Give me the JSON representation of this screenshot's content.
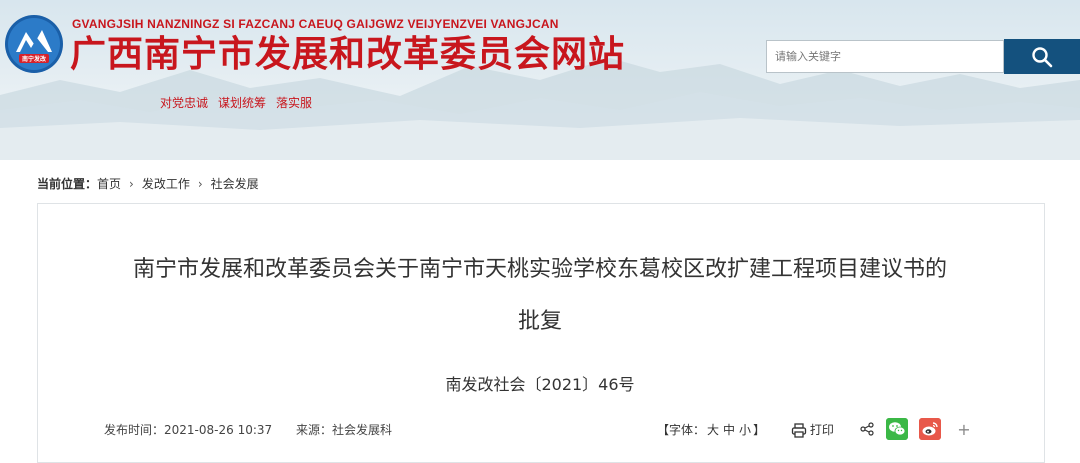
{
  "header": {
    "pinyin": "GVANGJSIH NANZNINGZ SI FAZCANJ CAEUQ GAIJGWZ VEIJYENZVEI VANGJCAN",
    "site_title": "广西南宁市发展和改革委员会网站",
    "logo_text": "南宁发改",
    "motto": [
      "对党忠诚",
      "谋划统筹",
      "落实服"
    ]
  },
  "search": {
    "placeholder": "请输入关键字",
    "value": ""
  },
  "breadcrumb": {
    "label": "当前位置：",
    "items": [
      "首页",
      "发改工作",
      "社会发展"
    ],
    "separator": "›"
  },
  "article": {
    "title_line1": "南宁市发展和改革委员会关于南宁市天桃实验学校东葛校区改扩建工程项目建议书的",
    "title_line2": "批复",
    "doc_number": "南发改社会〔2021〕46号",
    "publish_label": "发布时间：",
    "publish_time": "2021-08-26 10:37",
    "source_label": "来源：",
    "source": "社会发展科"
  },
  "tools": {
    "font_open": "【字体：",
    "font_large": "大",
    "font_medium": "中",
    "font_small": "小",
    "font_close": "】",
    "print": "打印",
    "plus": "+"
  },
  "colors": {
    "brand_red": "#c8161d",
    "search_button": "#14517e",
    "wechat": "#3bb846",
    "weibo": "#e8584a"
  },
  "icons": [
    "logo-emblem-icon",
    "search-icon",
    "print-icon",
    "share-icon",
    "wechat-icon",
    "weibo-icon"
  ]
}
